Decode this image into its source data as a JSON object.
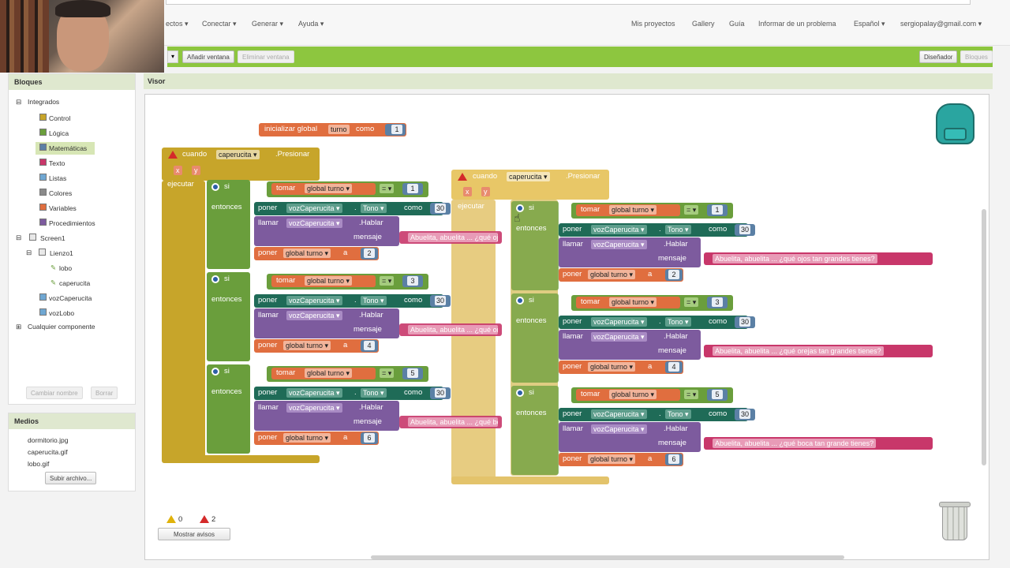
{
  "top_menu": {
    "items": [
      "ectos ▾",
      "Conectar ▾",
      "Generar ▾",
      "Ayuda ▾"
    ],
    "right": [
      "Mis proyectos",
      "Gallery",
      "Guía",
      "Informar de un problema",
      "Español ▾",
      "sergiopalay@gmail.com ▾"
    ]
  },
  "toolbar": {
    "add_screen": "Añadir ventana",
    "remove_screen": "Eliminar ventana",
    "designer": "Diseñador",
    "blocks": "Bloques",
    "dropdown": "▾"
  },
  "left_panel": {
    "title": "Bloques",
    "integrados": "Integrados",
    "categories": [
      "Control",
      "Lógica",
      "Matemáticas",
      "Texto",
      "Listas",
      "Colores",
      "Variables",
      "Procedimientos"
    ],
    "screen": "Screen1",
    "canvas": "Lienzo1",
    "sprites": [
      "lobo",
      "caperucita"
    ],
    "components": [
      "vozCaperucita",
      "vozLobo"
    ],
    "any_component": "Cualquier componente",
    "rename": "Cambiar nombre",
    "delete": "Borrar"
  },
  "media": {
    "title": "Medios",
    "files": [
      "dormitorio.jpg",
      "caperucita.gif",
      "lobo.gif"
    ],
    "upload": "Subir archivo..."
  },
  "visor": {
    "title": "Visor",
    "warnings": "0",
    "errors": "2",
    "show_warnings": "Mostrar avisos"
  },
  "blocks": {
    "init_global": "inicializar global",
    "var_turno": "turno",
    "como": "como",
    "init_val": "1",
    "cuando": "cuando",
    "caperucita": "caperucita ▾",
    "presionar": ".Presionar",
    "x": "x",
    "y": "y",
    "ejecutar": "ejecutar",
    "si": "si",
    "entonces": "entonces",
    "tomar": "tomar",
    "global_turno": "global turno ▾",
    "eq": "= ▾",
    "poner": "poner",
    "voz": "vozCaperucita ▾",
    "dot": ".",
    "tono": "Tono ▾",
    "tono_val": "30",
    "llamar": "llamar",
    "hablar": ".Hablar",
    "mensaje": "mensaje",
    "a": "a",
    "left_groups": [
      {
        "cond": "1",
        "msg": "Abuelita, abuelita ... ¿qué ojos tan grandes tienes?",
        "set": "2"
      },
      {
        "cond": "3",
        "msg": "Abuelita, abuelita ... ¿qué orejas tan grandes tienes?",
        "set": "4"
      },
      {
        "cond": "5",
        "msg": "Abuelita, abuelita ... ¿qué boca tan grandes tienes?",
        "set": "6"
      }
    ],
    "right_groups": [
      {
        "cond": "1",
        "msg": "Abuelita, abuelita ... ¿qué ojos tan grandes tienes?",
        "set": "2"
      },
      {
        "cond": "3",
        "msg": "Abuelita, abuelita ... ¿qué orejas tan grandes tienes?",
        "set": "4"
      },
      {
        "cond": "5",
        "msg": "Abuelita, abuelita ... ¿qué boca tan grande tienes?",
        "set": "6"
      }
    ]
  },
  "colors": {
    "green_bar": "#8dc63f",
    "event_block": "#c7a52a",
    "logic": "#6a9e3c",
    "variable": "#e06e3f",
    "component_set": "#1f6b57",
    "component_call": "#7d5b9e",
    "text": "#c8376a",
    "math": "#5b80a5"
  }
}
